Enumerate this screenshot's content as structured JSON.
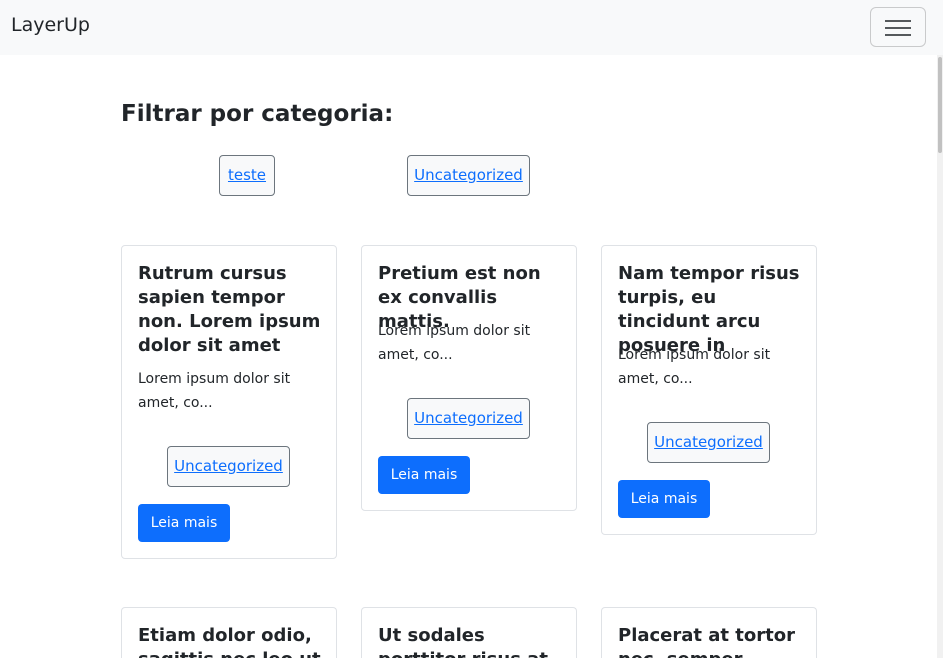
{
  "navbar": {
    "brand": "LayerUp",
    "toggler_icon": "hamburger-icon"
  },
  "filter": {
    "title": "Filtrar por categoria:",
    "categories": [
      "teste",
      "Uncategorized"
    ]
  },
  "posts": [
    {
      "title": "Rutrum cursus sapien tempor non. Lorem ipsum dolor sit amet",
      "excerpt": "Lorem ipsum dolor sit amet, co...",
      "category": "Uncategorized",
      "button": "Leia mais"
    },
    {
      "title": "Pretium est non ex convallis mattis.",
      "excerpt": "Lorem ipsum dolor sit amet, co...",
      "category": "Uncategorized",
      "button": "Leia mais"
    },
    {
      "title": "Nam tempor risus turpis, eu tincidunt arcu posuere in",
      "excerpt": "Lorem ipsum dolor sit amet, co...",
      "category": "Uncategorized",
      "button": "Leia mais"
    },
    {
      "title": "Etiam dolor odio, sagittis nec leo ut"
    },
    {
      "title": "Ut sodales porttitor risus at"
    },
    {
      "title": "Placerat at tortor nec, semper"
    }
  ],
  "colors": {
    "primary": "#0d6efd",
    "navbar_bg": "#f8f9fa",
    "text": "#212529"
  }
}
